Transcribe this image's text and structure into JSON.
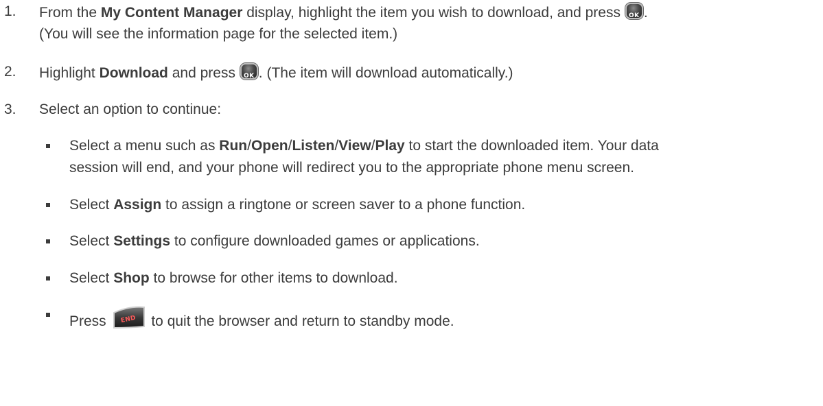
{
  "steps": [
    {
      "number": "1.",
      "line1": {
        "prefix": "From the ",
        "bold": "My Content Manager",
        "suffix": " display, highlight the item you wish to download, and press ",
        "end": "."
      },
      "line2": "(You will see the information page for the selected item.)"
    },
    {
      "number": "2.",
      "text_a": "Highlight ",
      "bold": "Download",
      "text_b": " and press ",
      "text_c": ". (The item will download automatically.)"
    },
    {
      "number": "3.",
      "text": "Select an option to continue:"
    }
  ],
  "options": [
    {
      "prefix": "Select a menu such as ",
      "menus": [
        "Run",
        "Open",
        "Listen",
        "View",
        "Play"
      ],
      "separator": "/",
      "suffix": " to start the downloaded item. Your data",
      "line2": "session will end, and your phone will redirect you to the appropriate phone menu screen."
    },
    {
      "prefix": "Select ",
      "bold": "Assign",
      "suffix": " to assign a ringtone or screen saver to a phone function."
    },
    {
      "prefix": "Select ",
      "bold": "Settings",
      "suffix": " to configure downloaded games or applications."
    },
    {
      "prefix": "Select ",
      "bold": "Shop",
      "suffix": " to browse for other items to download."
    },
    {
      "prefix": "Press ",
      "suffix": " to quit the browser and return to standby mode."
    }
  ],
  "keys": {
    "ok_label": "OK",
    "end_label": "END",
    "ok_icon": "ok-key-icon",
    "end_icon": "end-key-icon"
  }
}
